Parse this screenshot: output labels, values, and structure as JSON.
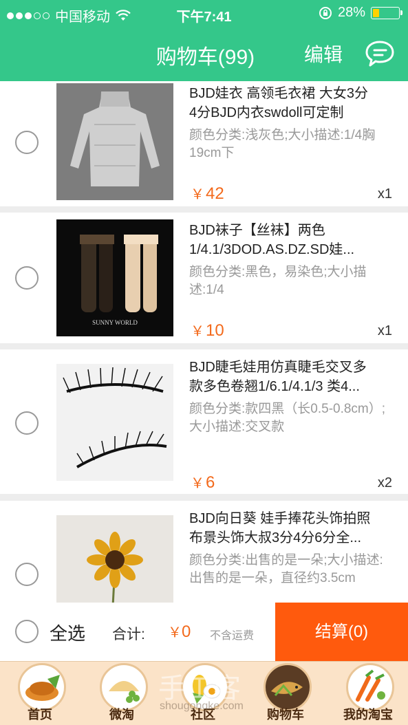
{
  "status_bar": {
    "carrier": "中国移动",
    "time": "下午7:41",
    "battery": "28%"
  },
  "header": {
    "title": "购物车(99)",
    "edit_label": "编辑"
  },
  "items": [
    {
      "title_line1": "BJD娃衣 高领毛衣裙 大女3分",
      "title_line2": "4分BJD内衣swdoll可定制",
      "spec": "颜色分类:浅灰色;大小描述:1/4胸19cm下",
      "price_symbol": "￥",
      "price": "42",
      "qty": "x1",
      "image": "gray-sweater-dress"
    },
    {
      "title_line1": "BJD袜子【丝袜】两色",
      "title_line2": "1/4.1/3DOD.AS.DZ.SD娃...",
      "spec": "颜色分类:黑色，易染色;大小描述:1/4",
      "price_symbol": "￥",
      "price": "10",
      "qty": "x1",
      "image": "doll-stockings",
      "image_caption": "SUNNY WORLD"
    },
    {
      "title_line1": "BJD睫毛娃用仿真睫毛交叉多",
      "title_line2": "款多色卷翘1/6.1/4.1/3 类4...",
      "spec": "颜色分类:款四黑（长0.5-0.8cm）;大小描述:交叉款",
      "price_symbol": "￥",
      "price": "6",
      "qty": "x2",
      "image": "eyelashes"
    },
    {
      "title_line1": "BJD向日葵 娃手捧花头饰拍照",
      "title_line2": "布景头饰大叔3分4分6分全...",
      "spec": "颜色分类:出售的是一朵;大小描述:出售的是一朵，直径约3.5cm",
      "price_symbol": "￥",
      "price": "",
      "qty": "",
      "image": "sunflower"
    }
  ],
  "footer": {
    "select_all": "全选",
    "total_label": "合计:",
    "total_symbol": "￥",
    "total_value": "0",
    "shipping_note": "不含运费",
    "checkout_label": "结算(0)"
  },
  "tabs": [
    {
      "label": "首页",
      "icon": "home-food-icon"
    },
    {
      "label": "微淘",
      "icon": "weitao-food-icon"
    },
    {
      "label": "社区",
      "icon": "community-food-icon"
    },
    {
      "label": "购物车",
      "icon": "cart-food-icon"
    },
    {
      "label": "我的淘宝",
      "icon": "my-taobao-food-icon"
    }
  ],
  "watermark": {
    "text": "手工客",
    "url": "shougongke.com"
  },
  "colors": {
    "header_green": "#34c78a",
    "price_orange": "#f36a1c",
    "checkout_orange": "#ff5a0d"
  }
}
